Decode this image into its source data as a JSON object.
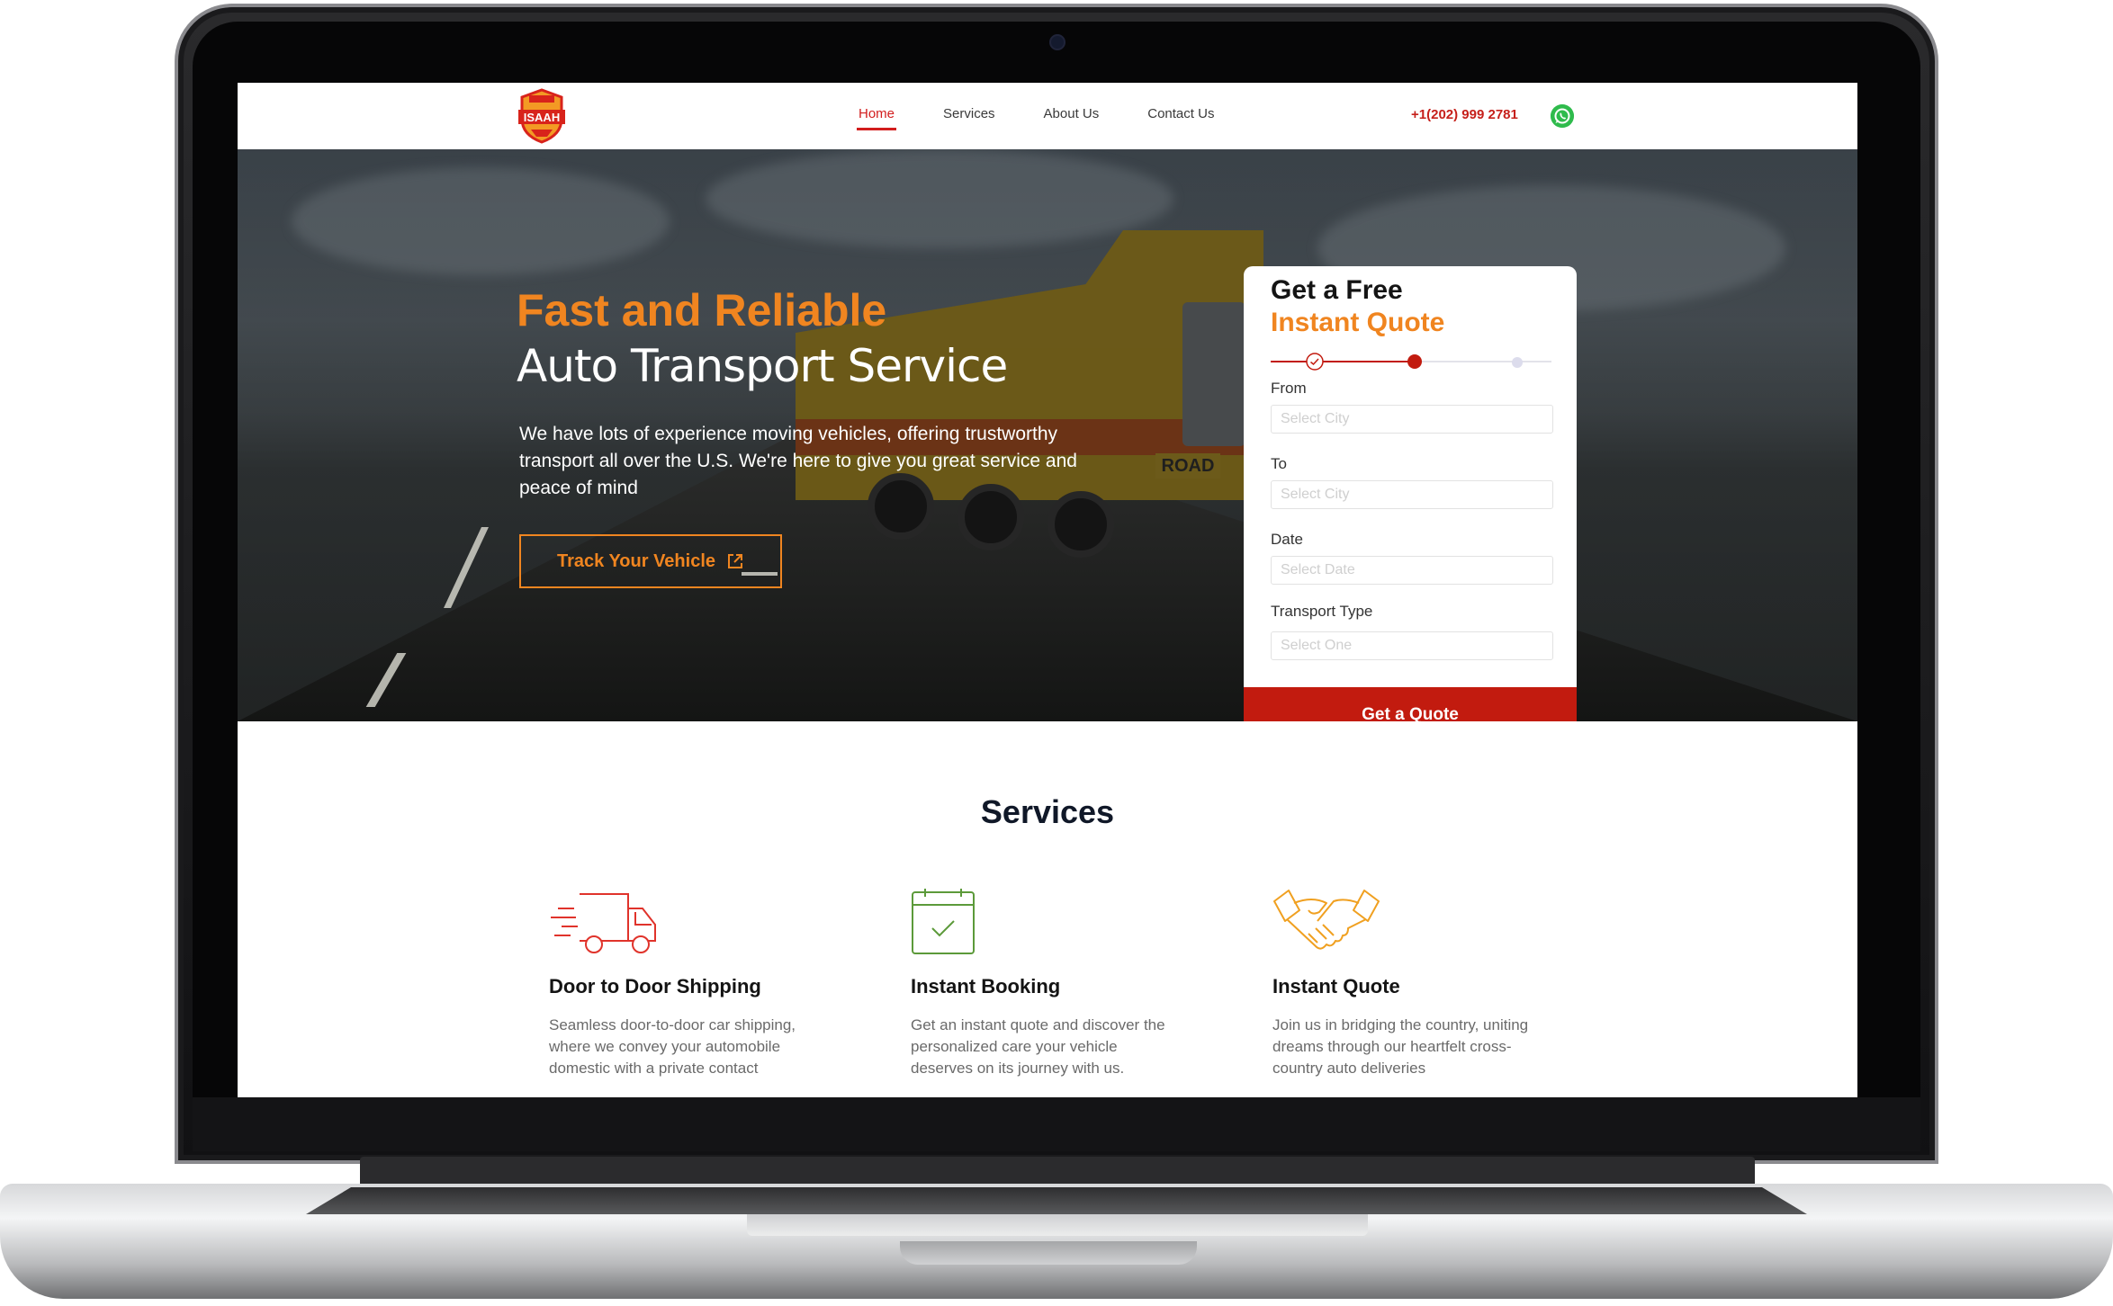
{
  "nav": {
    "logo_text": "ISAAH",
    "links": [
      {
        "label": "Home",
        "active": true
      },
      {
        "label": "Services",
        "active": false
      },
      {
        "label": "About Us",
        "active": false
      },
      {
        "label": "Contact Us",
        "active": false
      }
    ],
    "phone": "+1(202) 999 2781",
    "whatsapp_icon": "whatsapp-icon"
  },
  "hero": {
    "title_line1": "Fast and Reliable",
    "title_line2": "Auto Transport Service",
    "description": "We have lots of experience moving vehicles, offering trustworthy transport all over the U.S. We're here to give you great service and peace of mind",
    "track_button": "Track Your Vehicle",
    "truck_plate": "ROAD"
  },
  "quote": {
    "title_line1": "Get a Free",
    "title_line2": "Instant Quote",
    "steps": [
      "completed",
      "current",
      "upcoming"
    ],
    "fields": [
      {
        "label": "From",
        "placeholder": "Select City"
      },
      {
        "label": "To",
        "placeholder": "Select City"
      },
      {
        "label": "Date",
        "placeholder": "Select Date"
      },
      {
        "label": "Transport Type",
        "placeholder": "Select One"
      }
    ],
    "submit": "Get a Quote"
  },
  "services": {
    "title": "Services",
    "items": [
      {
        "name": "Door to Door Shipping",
        "description": "Seamless door-to-door car shipping, where we convey your automobile domestic with a private contact",
        "icon": "delivery-truck-icon"
      },
      {
        "name": "Instant Booking",
        "description": "Get an instant quote and discover the personalized care your vehicle deserves on its  journey with us.",
        "icon": "calendar-check-icon"
      },
      {
        "name": "Instant Quote",
        "description": "Join us in bridging the country, uniting dreams through our heartfelt cross-country auto deliveries",
        "icon": "handshake-icon"
      }
    ]
  },
  "colors": {
    "brand_orange": "#f08520",
    "brand_red": "#c21b0f",
    "nav_active": "#d21d1d",
    "whatsapp_green": "#2fbb4c"
  }
}
